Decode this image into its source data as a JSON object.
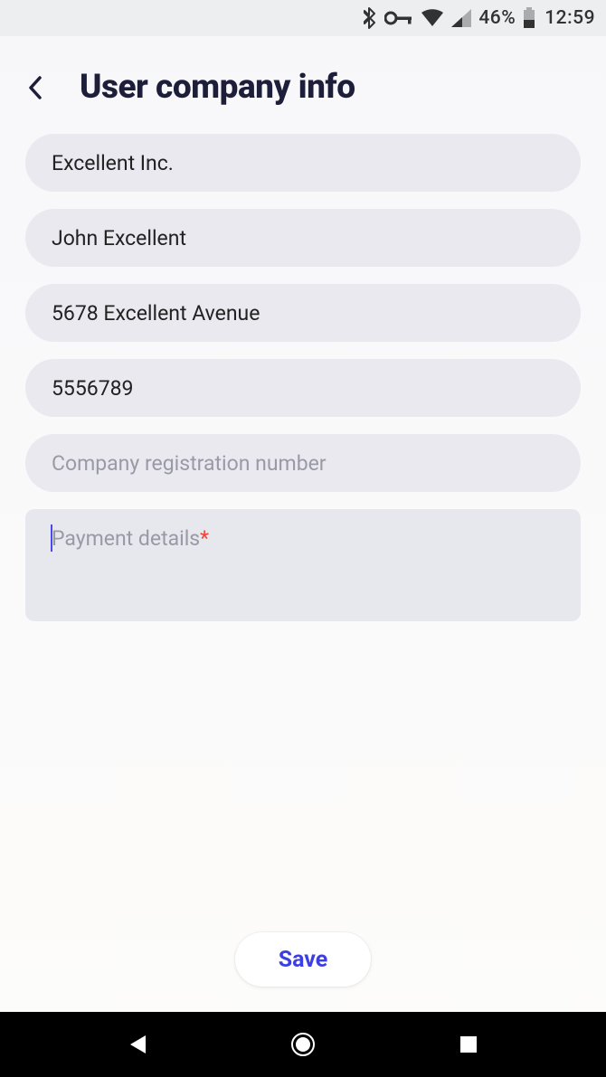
{
  "status_bar": {
    "battery_text": "46%",
    "time": "12:59"
  },
  "header": {
    "title": "User company info"
  },
  "form": {
    "company_name": {
      "value": "Excellent Inc."
    },
    "contact_name": {
      "value": "John Excellent"
    },
    "address": {
      "value": "5678 Excellent Avenue"
    },
    "phone": {
      "value": "5556789"
    },
    "reg_number": {
      "value": "",
      "placeholder": "Company registration number"
    },
    "payment_details": {
      "value": "",
      "placeholder": "Payment details",
      "required_mark": "*"
    }
  },
  "footer": {
    "save_label": "Save"
  }
}
